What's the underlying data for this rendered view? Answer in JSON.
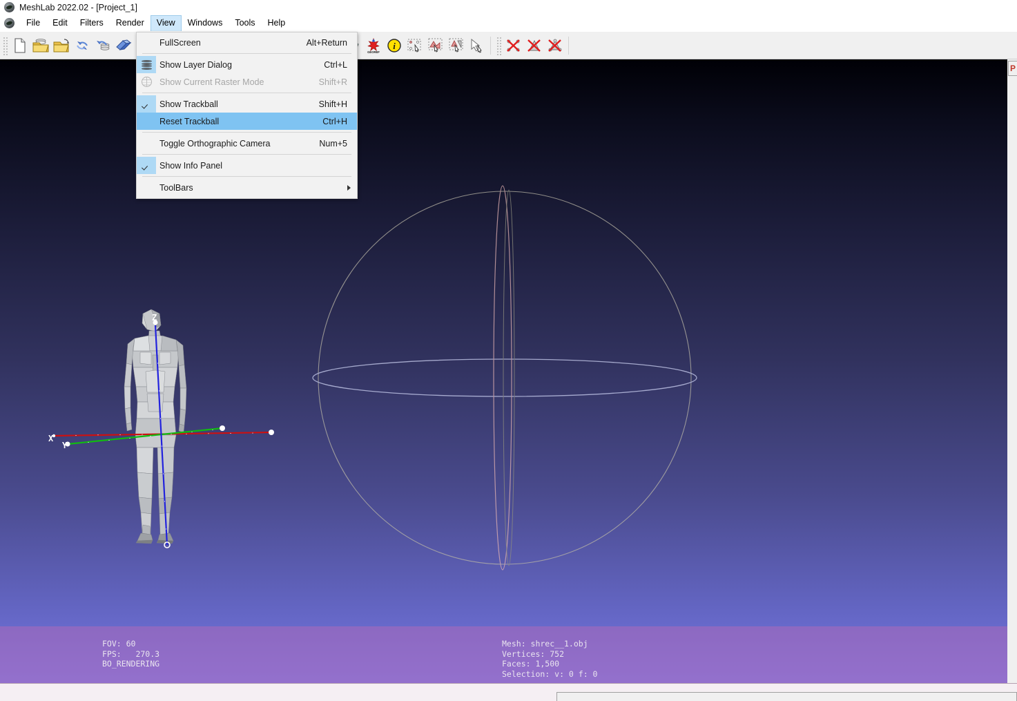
{
  "window": {
    "title": "MeshLab 2022.02 - [Project_1]",
    "logo_icon": "meshlab-logo-icon"
  },
  "menubar": {
    "items": [
      {
        "label": "File",
        "active": false
      },
      {
        "label": "Edit",
        "active": false
      },
      {
        "label": "Filters",
        "active": false
      },
      {
        "label": "Render",
        "active": false
      },
      {
        "label": "View",
        "active": true
      },
      {
        "label": "Windows",
        "active": false
      },
      {
        "label": "Tools",
        "active": false
      },
      {
        "label": "Help",
        "active": false
      }
    ]
  },
  "toolbar": {
    "groups": [
      {
        "name": "file-group",
        "buttons": [
          {
            "icon": "new-document-icon",
            "title": "New Empty Project"
          },
          {
            "icon": "open-project-icon",
            "title": "Open Project"
          },
          {
            "icon": "import-mesh-icon",
            "title": "Import Mesh"
          },
          {
            "icon": "reload-icon",
            "title": "Reload"
          },
          {
            "icon": "save-project-icon",
            "title": "Save Project"
          },
          {
            "icon": "export-mesh-icon",
            "title": "Export Mesh"
          }
        ]
      },
      {
        "name": "render-group",
        "buttons": [
          {
            "icon": "sphere-wireframe-icon",
            "title": "Show Trackball"
          },
          {
            "icon": "letter-a-circle-icon",
            "title": "Show Axis"
          },
          {
            "icon": "axis-gizmo-icon",
            "title": "Show Quoted Box"
          },
          {
            "icon": "yellow-paint-icon",
            "title": "Render Mode"
          },
          {
            "icon": "camera-raster-align-icon",
            "title": "Raster Alignment"
          },
          {
            "icon": "paintbrush-icon",
            "title": "Z-Painting"
          },
          {
            "icon": "pp-points-icon",
            "title": "PickPoints"
          },
          {
            "icon": "measure-points-icon",
            "title": "Measuring Tool"
          }
        ]
      },
      {
        "name": "edit-group",
        "buttons": [
          {
            "icon": "align-meshes-icon",
            "title": "Align"
          },
          {
            "icon": "colorize-icon",
            "title": "Vertex Color Paint"
          },
          {
            "icon": "georef-icon",
            "title": "GeoReferencing"
          },
          {
            "icon": "info-circle-icon",
            "title": "Get Info"
          },
          {
            "icon": "select-vertices-icon",
            "title": "Select Vertices"
          },
          {
            "icon": "select-faces-icon",
            "title": "Select Faces"
          },
          {
            "icon": "select-connected-icon",
            "title": "Select Connected Component"
          },
          {
            "icon": "arrow-cursor-icon",
            "title": "Move Selection"
          }
        ]
      },
      {
        "name": "delete-group",
        "buttons": [
          {
            "icon": "delete-vertices-icon",
            "title": "Delete Selected Vertices"
          },
          {
            "icon": "delete-faces-icon",
            "title": "Delete Selected Faces"
          },
          {
            "icon": "delete-faces-vertices-icon",
            "title": "Delete Selected Faces and Vertices"
          }
        ]
      }
    ]
  },
  "view_menu": {
    "rows": [
      {
        "type": "item",
        "label": "FullScreen",
        "shortcut": "Alt+Return",
        "icon": null,
        "checked": false,
        "disabled": false,
        "highlight": false,
        "submenu": false
      },
      {
        "type": "separator"
      },
      {
        "type": "item",
        "label": "Show Layer Dialog",
        "shortcut": "Ctrl+L",
        "icon": "layer-stack-icon",
        "checked": false,
        "disabled": false,
        "highlight": false,
        "submenu": false
      },
      {
        "type": "item",
        "label": "Show Current Raster Mode",
        "shortcut": "Shift+R",
        "icon": "raster-globe-icon",
        "checked": false,
        "disabled": true,
        "highlight": false,
        "submenu": false
      },
      {
        "type": "separator"
      },
      {
        "type": "item",
        "label": "Show Trackball",
        "shortcut": "Shift+H",
        "icon": "check-icon",
        "checked": true,
        "disabled": false,
        "highlight": false,
        "submenu": false
      },
      {
        "type": "item",
        "label": "Reset Trackball",
        "shortcut": "Ctrl+H",
        "icon": null,
        "checked": false,
        "disabled": false,
        "highlight": true,
        "submenu": false
      },
      {
        "type": "separator"
      },
      {
        "type": "item",
        "label": "Toggle Orthographic Camera",
        "shortcut": "Num+5",
        "icon": null,
        "checked": false,
        "disabled": false,
        "highlight": false,
        "submenu": false
      },
      {
        "type": "separator"
      },
      {
        "type": "item",
        "label": "Show Info Panel",
        "shortcut": "",
        "icon": "check-icon",
        "checked": true,
        "disabled": false,
        "highlight": false,
        "submenu": false
      },
      {
        "type": "separator"
      },
      {
        "type": "item",
        "label": "ToolBars",
        "shortcut": "",
        "icon": null,
        "checked": false,
        "disabled": false,
        "highlight": false,
        "submenu": true
      }
    ]
  },
  "viewport": {
    "background_top": "#000006",
    "background_bottom": "#7376de",
    "trackball": {
      "visible": true,
      "outline_color": "#b9b6a6",
      "equator_color": "#cdd2f2",
      "meridian_color": "#e6b4b4"
    },
    "axis_gizmo": {
      "x_color": "#cc0000",
      "y_color": "#00bb00",
      "z_color": "#2222dd",
      "labels": [
        "X",
        "Y",
        "Z"
      ]
    },
    "mesh_color": "#c8c8c8"
  },
  "info_panel": {
    "visible": true,
    "left_lines": [
      "FOV: 60",
      "FPS:   270.3",
      "BO_RENDERING"
    ],
    "right_lines": [
      "Mesh: shrec__1.obj",
      "Vertices: 752",
      "Faces: 1,500",
      "Selection: v: 0 f: 0"
    ]
  },
  "right_dock": {
    "label": "P"
  }
}
